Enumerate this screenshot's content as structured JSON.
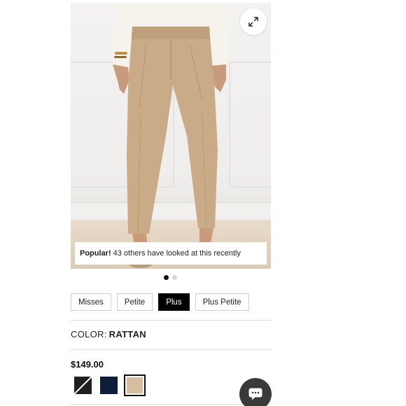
{
  "product": {
    "image_alt": "Model wearing tan ankle pants",
    "popular_label": "Popular!",
    "popular_text": "43 others have looked at this recently",
    "carousel": {
      "total": 2,
      "active": 1
    }
  },
  "sizes": [
    {
      "label": "Misses",
      "selected": false
    },
    {
      "label": "Petite",
      "selected": false
    },
    {
      "label": "Plus",
      "selected": true
    },
    {
      "label": "Plus Petite",
      "selected": false
    }
  ],
  "color": {
    "prefix": "COLOR:",
    "name": "RATTAN"
  },
  "price": "$149.00",
  "swatches": [
    {
      "name": "black-unavailable",
      "color": "#1f1f1f",
      "unavailable": true
    },
    {
      "name": "navy",
      "color": "#0d1e3d"
    },
    {
      "name": "rattan",
      "color": "#d7bd9f",
      "selected": true
    }
  ],
  "icons": {
    "expand": "expand-icon",
    "chat": "chat-icon"
  }
}
